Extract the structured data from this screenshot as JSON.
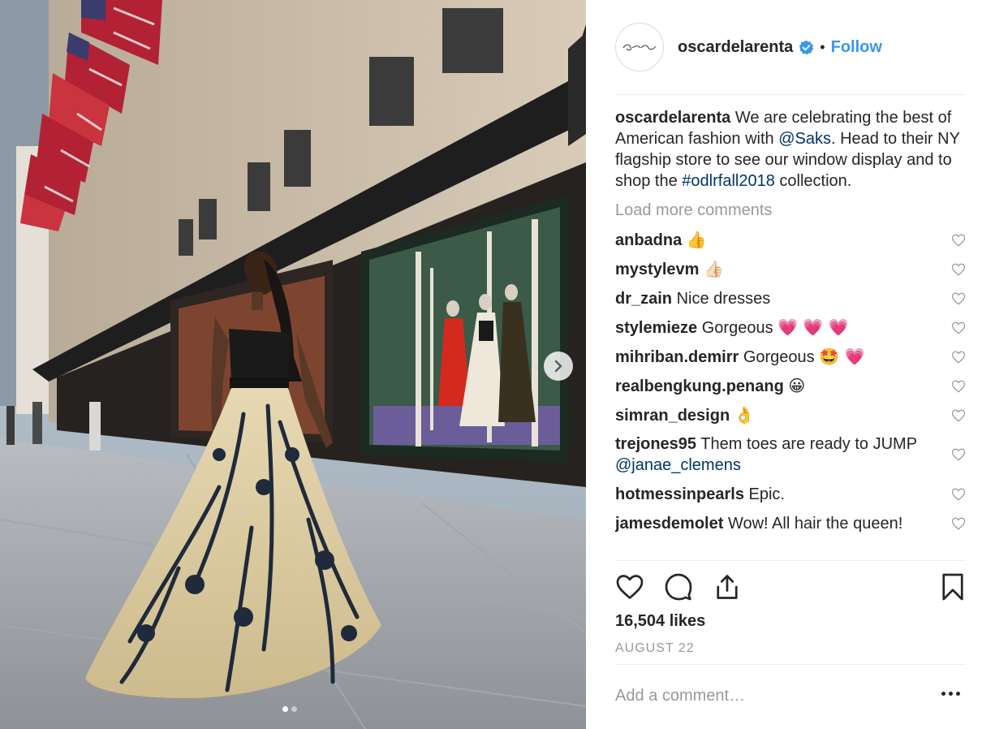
{
  "post": {
    "username": "oscardelarenta",
    "follow_label": "Follow",
    "separator": "•",
    "caption": {
      "user": "oscardelarenta",
      "text_1": " We are celebrating the best of American fashion with ",
      "mention": "@Saks",
      "text_2": ". Head to their NY flagship store to see our window display and to shop the ",
      "hashtag": "#odlrfall2018",
      "text_3": " collection."
    },
    "load_more_label": "Load more comments",
    "comments": [
      {
        "user": "anbadna",
        "text": "",
        "emoji": "👍"
      },
      {
        "user": "mystylevm",
        "text": "",
        "emoji": "👍🏻"
      },
      {
        "user": "dr_zain",
        "text": "Nice dresses",
        "emoji": ""
      },
      {
        "user": "stylemieze",
        "text": "Gorgeous",
        "emoji": "💗 💗 💗"
      },
      {
        "user": "mihriban.demirr",
        "text": "Gorgeous",
        "emoji": "🤩 💗"
      },
      {
        "user": "realbengkung.penang",
        "text": "",
        "emoji": "😀"
      },
      {
        "user": "simran_design",
        "text": "",
        "emoji": "👌"
      },
      {
        "user": "trejones95",
        "text": "Them toes are ready to JUMP ",
        "mention": "@janae_clemens"
      },
      {
        "user": "hotmessinpearls",
        "text": "Epic.",
        "emoji": ""
      },
      {
        "user": "jamesdemolet",
        "text": "Wow! All hair the queen!",
        "emoji": ""
      }
    ],
    "likes": "16,504 likes",
    "date": "AUGUST 22",
    "add_comment_placeholder": "Add a comment…",
    "carousel": {
      "total": 2,
      "current": 1
    }
  },
  "colors": {
    "accent": "#3897f0",
    "link": "#003569",
    "muted": "#999999",
    "text": "#262626",
    "divider": "#efefef"
  },
  "icons": [
    "verified-badge-icon",
    "heart-icon",
    "comment-icon",
    "share-icon",
    "bookmark-icon",
    "chevron-right-icon",
    "more-icon"
  ]
}
